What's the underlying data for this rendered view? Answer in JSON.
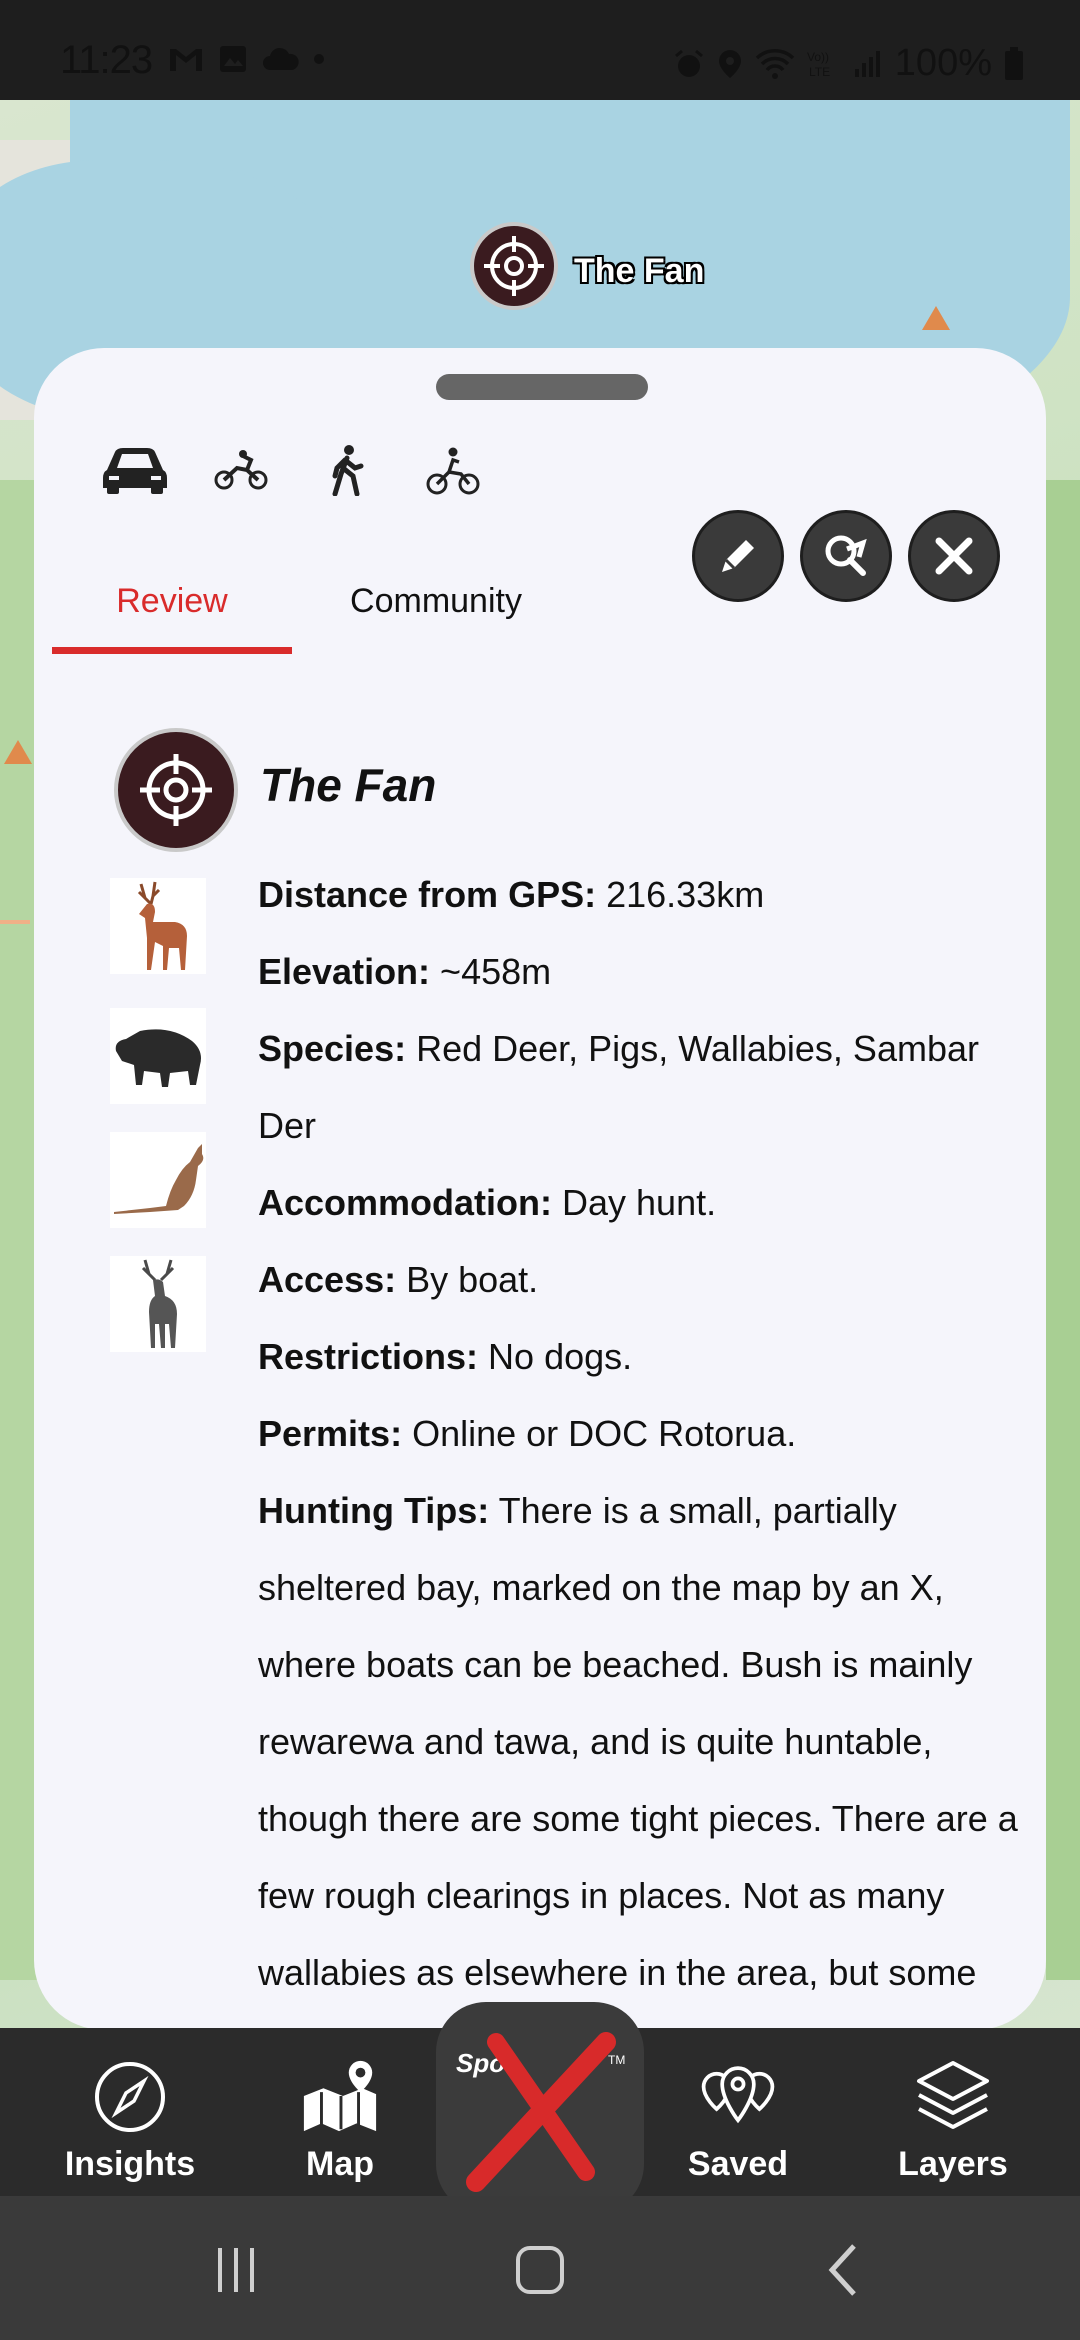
{
  "status_bar": {
    "time": "11:23",
    "battery": "100%",
    "left_icons": [
      "gmail-icon",
      "image-icon",
      "cloud-icon",
      "dot-icon"
    ],
    "right_icons": [
      "alarm-icon",
      "location-icon",
      "wifi-calling-icon",
      "volte-icon",
      "signal-icon",
      "battery-icon"
    ],
    "network_label": "VoLTE"
  },
  "map": {
    "marker_label": "The Fan"
  },
  "sheet": {
    "modes": [
      "car-icon",
      "motorbike-icon",
      "walking-icon",
      "bicycle-icon"
    ],
    "actions": [
      "edit-icon",
      "share-search-icon",
      "close-icon"
    ],
    "tabs": [
      {
        "label": "Review",
        "active": true
      },
      {
        "label": "Community",
        "active": false
      }
    ],
    "poi": {
      "title": "The Fan",
      "animals": [
        "deer-icon",
        "pig-icon",
        "wallaby-icon",
        "stag-icon"
      ],
      "facts": [
        {
          "label": "Distance from GPS:",
          "value": " 216.33km"
        },
        {
          "label": "Elevation:",
          "value": " ~458m"
        },
        {
          "label": "Species:",
          "value": " Red Deer, Pigs, Wallabies, Sambar Der"
        },
        {
          "label": "Accommodation:",
          "value": " Day hunt."
        },
        {
          "label": "Access:",
          "value": " By boat."
        },
        {
          "label": "Restrictions:",
          "value": " No dogs."
        },
        {
          "label": "Permits:",
          "value": " Online or DOC Rotorua."
        },
        {
          "label": "Hunting Tips:",
          "value": " There is a small, partially sheltered bay, marked on the map by an X, where boats can be beached. Bush is mainly rewarewa and tawa, and is quite huntable, though there are some tight pieces. There are a few rough clearings in places. Not as many wallabies as elsewhere in the area, but some good"
        }
      ]
    }
  },
  "bottom_nav": {
    "items": [
      {
        "label": "Insights",
        "icon": "compass-icon"
      },
      {
        "label": "Map",
        "icon": "map-pin-icon"
      },
      {
        "label": "Saved",
        "icon": "saved-pins-icon"
      },
      {
        "label": "Layers",
        "icon": "layers-icon"
      }
    ],
    "center_logo_text": "Spot",
    "center_logo_tm": "TM"
  },
  "system_nav": [
    "recents-button",
    "home-button",
    "back-button"
  ]
}
